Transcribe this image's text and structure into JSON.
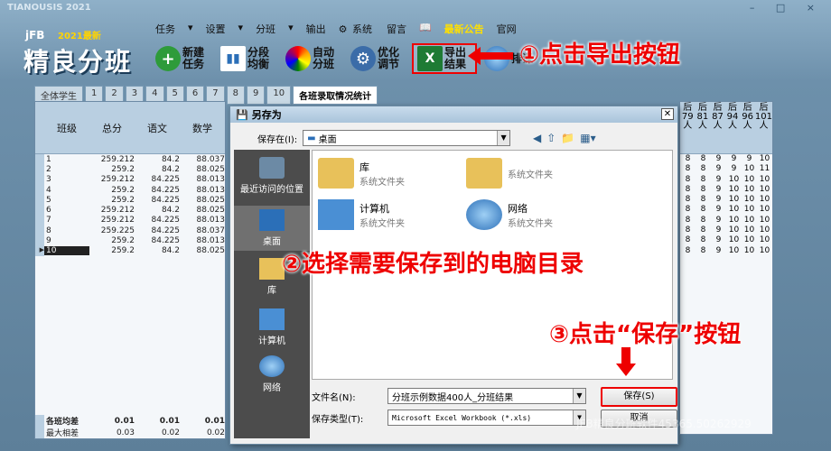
{
  "app": {
    "window_title": "TIANOUSIS 2021",
    "brand_small": "jFB",
    "brand_year": "2021最新",
    "brand_big": "精良分班"
  },
  "menu": [
    "任务",
    "设置",
    "分班",
    "输出",
    "系统",
    "留言",
    "",
    "",
    "官网"
  ],
  "menu_highlight": "最新公告",
  "toolbar": [
    {
      "label": "新建任务",
      "icon": "plus-icon"
    },
    {
      "label": "分段均衡",
      "icon": "bar-chart-icon"
    },
    {
      "label": "自动分班",
      "icon": "color-wheel-icon"
    },
    {
      "label": "优化调节",
      "icon": "gear-icon"
    },
    {
      "label": "导出结果",
      "icon": "excel-icon"
    },
    {
      "label": "排课",
      "icon": "globe-icon"
    }
  ],
  "annotations": {
    "step1": "①点击导出按钮",
    "step2": "②选择需要保存到的电脑目录",
    "step3": "③点击“保存”按钮"
  },
  "tabs": [
    "全体学生",
    "1",
    "2",
    "3",
    "4",
    "5",
    "6",
    "7",
    "8",
    "9",
    "10",
    "各班录取情况统计"
  ],
  "grid": {
    "headers": [
      "班级",
      "总分",
      "语文",
      "数学"
    ],
    "rows": [
      [
        "1",
        "259.212",
        "84.2",
        "88.037"
      ],
      [
        "2",
        "259.2",
        "84.2",
        "88.025"
      ],
      [
        "3",
        "259.212",
        "84.225",
        "88.013"
      ],
      [
        "4",
        "259.2",
        "84.225",
        "88.013"
      ],
      [
        "5",
        "259.2",
        "84.225",
        "88.025"
      ],
      [
        "6",
        "259.212",
        "84.2",
        "88.025"
      ],
      [
        "7",
        "259.212",
        "84.225",
        "88.013"
      ],
      [
        "8",
        "259.225",
        "84.225",
        "88.037"
      ],
      [
        "9",
        "259.2",
        "84.225",
        "88.013"
      ],
      [
        "10",
        "259.2",
        "84.2",
        "88.025"
      ]
    ],
    "footer": [
      [
        "各班均差",
        "0.01",
        "0.01",
        "0.01"
      ],
      [
        "最大相差",
        "0.03",
        "0.02",
        "0.02"
      ]
    ]
  },
  "right_grid": {
    "headers": [
      "后79人",
      "后81人",
      "后87人",
      "后94人",
      "后96人",
      "后101人"
    ],
    "rows": [
      [
        "8",
        "8",
        "9",
        "9",
        "9",
        "10"
      ],
      [
        "8",
        "8",
        "9",
        "9",
        "10",
        "11"
      ],
      [
        "8",
        "8",
        "9",
        "10",
        "10",
        "10"
      ],
      [
        "8",
        "8",
        "9",
        "10",
        "10",
        "10"
      ],
      [
        "8",
        "8",
        "9",
        "10",
        "10",
        "10"
      ],
      [
        "8",
        "8",
        "9",
        "10",
        "10",
        "10"
      ],
      [
        "8",
        "8",
        "9",
        "10",
        "10",
        "10"
      ],
      [
        "8",
        "8",
        "9",
        "10",
        "10",
        "10"
      ],
      [
        "8",
        "8",
        "9",
        "10",
        "10",
        "10"
      ],
      [
        "8",
        "8",
        "9",
        "10",
        "10",
        "10"
      ]
    ]
  },
  "dialog": {
    "title": "另存为",
    "save_in_label": "保存在(I):",
    "save_in_value": "桌面",
    "places": [
      "最近访问的位置",
      "桌面",
      "库",
      "计算机",
      "网络"
    ],
    "items": [
      {
        "name": "库",
        "desc": "系统文件夹"
      },
      {
        "name": "",
        "desc": "系统文件夹"
      },
      {
        "name": "计算机",
        "desc": "系统文件夹"
      },
      {
        "name": "网络",
        "desc": "系统文件夹"
      }
    ],
    "filename_label": "文件名(N):",
    "filename_value": "分班示例数据400人_分班结果",
    "filetype_label": "保存类型(T):",
    "filetype_value": "Microsoft Excel Workbook (*.xls)",
    "save_button": "保存(S)",
    "cancel_button": "取消"
  },
  "watermark": "JFB精良分班软件45365.50262929",
  "colors": {
    "accent_red": "#e00000",
    "excel_green": "#1e7b34"
  }
}
